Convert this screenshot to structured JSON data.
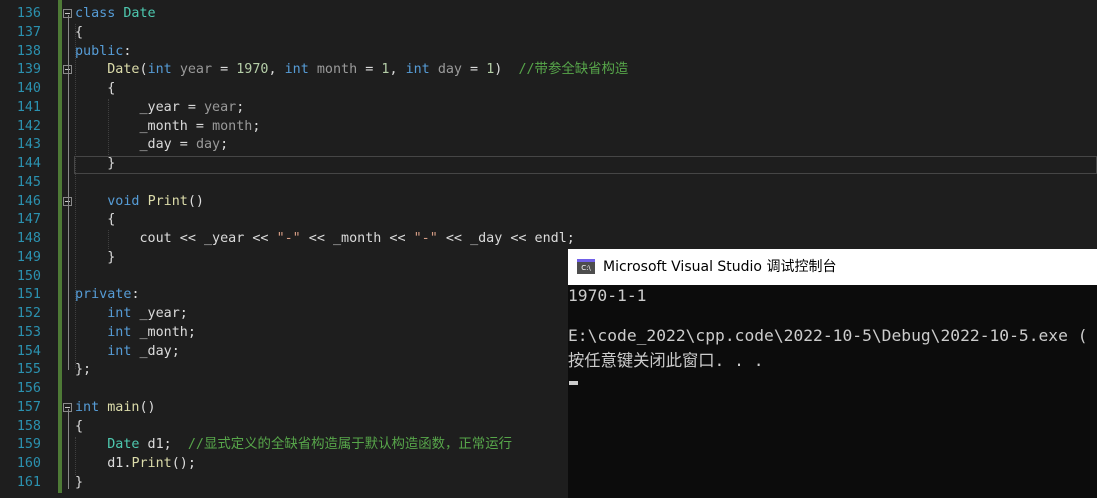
{
  "editor": {
    "lines": [
      {
        "num": "136",
        "tokens": [
          {
            "t": "class ",
            "c": "kw"
          },
          {
            "t": "Date",
            "c": "ty"
          }
        ]
      },
      {
        "num": "137",
        "tokens": [
          {
            "t": "{",
            "c": ""
          }
        ]
      },
      {
        "num": "138",
        "tokens": [
          {
            "t": "public",
            "c": "kw"
          },
          {
            "t": ":",
            "c": ""
          }
        ]
      },
      {
        "num": "139",
        "tokens": [
          {
            "t": "    ",
            "c": ""
          },
          {
            "t": "Date",
            "c": "fn"
          },
          {
            "t": "(",
            "c": ""
          },
          {
            "t": "int",
            "c": "kw"
          },
          {
            "t": " ",
            "c": ""
          },
          {
            "t": "year",
            "c": "pm"
          },
          {
            "t": " = ",
            "c": ""
          },
          {
            "t": "1970",
            "c": "nm"
          },
          {
            "t": ", ",
            "c": ""
          },
          {
            "t": "int",
            "c": "kw"
          },
          {
            "t": " ",
            "c": ""
          },
          {
            "t": "month",
            "c": "pm"
          },
          {
            "t": " = ",
            "c": ""
          },
          {
            "t": "1",
            "c": "nm"
          },
          {
            "t": ", ",
            "c": ""
          },
          {
            "t": "int",
            "c": "kw"
          },
          {
            "t": " ",
            "c": ""
          },
          {
            "t": "day",
            "c": "pm"
          },
          {
            "t": " = ",
            "c": ""
          },
          {
            "t": "1",
            "c": "nm"
          },
          {
            "t": ")  ",
            "c": ""
          },
          {
            "t": "//带参全缺省构造",
            "c": "cm"
          }
        ]
      },
      {
        "num": "140",
        "tokens": [
          {
            "t": "    {",
            "c": ""
          }
        ]
      },
      {
        "num": "141",
        "tokens": [
          {
            "t": "        ",
            "c": ""
          },
          {
            "t": "_year",
            "c": "ac"
          },
          {
            "t": " = ",
            "c": ""
          },
          {
            "t": "year",
            "c": "pm"
          },
          {
            "t": ";",
            "c": ""
          }
        ]
      },
      {
        "num": "142",
        "tokens": [
          {
            "t": "        ",
            "c": ""
          },
          {
            "t": "_month",
            "c": "ac"
          },
          {
            "t": " = ",
            "c": ""
          },
          {
            "t": "month",
            "c": "pm"
          },
          {
            "t": ";",
            "c": ""
          }
        ]
      },
      {
        "num": "143",
        "tokens": [
          {
            "t": "        ",
            "c": ""
          },
          {
            "t": "_day",
            "c": "ac"
          },
          {
            "t": " = ",
            "c": ""
          },
          {
            "t": "day",
            "c": "pm"
          },
          {
            "t": ";",
            "c": ""
          }
        ]
      },
      {
        "num": "144",
        "tokens": [
          {
            "t": "    }",
            "c": ""
          }
        ]
      },
      {
        "num": "145",
        "tokens": []
      },
      {
        "num": "146",
        "tokens": [
          {
            "t": "    ",
            "c": ""
          },
          {
            "t": "void",
            "c": "kw"
          },
          {
            "t": " ",
            "c": ""
          },
          {
            "t": "Print",
            "c": "fn"
          },
          {
            "t": "()",
            "c": ""
          }
        ]
      },
      {
        "num": "147",
        "tokens": [
          {
            "t": "    {",
            "c": ""
          }
        ]
      },
      {
        "num": "148",
        "tokens": [
          {
            "t": "        cout << ",
            "c": ""
          },
          {
            "t": "_year",
            "c": "ac"
          },
          {
            "t": " << ",
            "c": ""
          },
          {
            "t": "\"-\"",
            "c": "st"
          },
          {
            "t": " << ",
            "c": ""
          },
          {
            "t": "_month",
            "c": "ac"
          },
          {
            "t": " << ",
            "c": ""
          },
          {
            "t": "\"-\"",
            "c": "st"
          },
          {
            "t": " << ",
            "c": ""
          },
          {
            "t": "_day",
            "c": "ac"
          },
          {
            "t": " << endl;",
            "c": ""
          }
        ]
      },
      {
        "num": "149",
        "tokens": [
          {
            "t": "    }",
            "c": ""
          }
        ]
      },
      {
        "num": "150",
        "tokens": []
      },
      {
        "num": "151",
        "tokens": [
          {
            "t": "private",
            "c": "kw"
          },
          {
            "t": ":",
            "c": ""
          }
        ]
      },
      {
        "num": "152",
        "tokens": [
          {
            "t": "    ",
            "c": ""
          },
          {
            "t": "int",
            "c": "kw"
          },
          {
            "t": " _year;",
            "c": ""
          }
        ]
      },
      {
        "num": "153",
        "tokens": [
          {
            "t": "    ",
            "c": ""
          },
          {
            "t": "int",
            "c": "kw"
          },
          {
            "t": " _month;",
            "c": ""
          }
        ]
      },
      {
        "num": "154",
        "tokens": [
          {
            "t": "    ",
            "c": ""
          },
          {
            "t": "int",
            "c": "kw"
          },
          {
            "t": " _day;",
            "c": ""
          }
        ]
      },
      {
        "num": "155",
        "tokens": [
          {
            "t": "};",
            "c": ""
          }
        ]
      },
      {
        "num": "156",
        "tokens": []
      },
      {
        "num": "157",
        "tokens": [
          {
            "t": "int",
            "c": "kw"
          },
          {
            "t": " ",
            "c": ""
          },
          {
            "t": "main",
            "c": "fn"
          },
          {
            "t": "()",
            "c": ""
          }
        ]
      },
      {
        "num": "158",
        "tokens": [
          {
            "t": "{",
            "c": ""
          }
        ]
      },
      {
        "num": "159",
        "tokens": [
          {
            "t": "    ",
            "c": ""
          },
          {
            "t": "Date",
            "c": "ty"
          },
          {
            "t": " d1;  ",
            "c": ""
          },
          {
            "t": "//显式定义的全缺省构造属于默认构造函数，正常运行",
            "c": "cm"
          }
        ]
      },
      {
        "num": "160",
        "tokens": [
          {
            "t": "    d1.",
            "c": ""
          },
          {
            "t": "Print",
            "c": "fn"
          },
          {
            "t": "();",
            "c": ""
          }
        ]
      },
      {
        "num": "161",
        "tokens": [
          {
            "t": "}",
            "c": ""
          }
        ]
      }
    ]
  },
  "console": {
    "title": "Microsoft Visual Studio 调试控制台",
    "icon_label": "C:\\",
    "output": "1970-1-1",
    "exit_line": "E:\\code_2022\\cpp.code\\2022-10-5\\Debug\\2022-10-5.exe (",
    "press_key_line": "按任意键关闭此窗口. . ."
  }
}
